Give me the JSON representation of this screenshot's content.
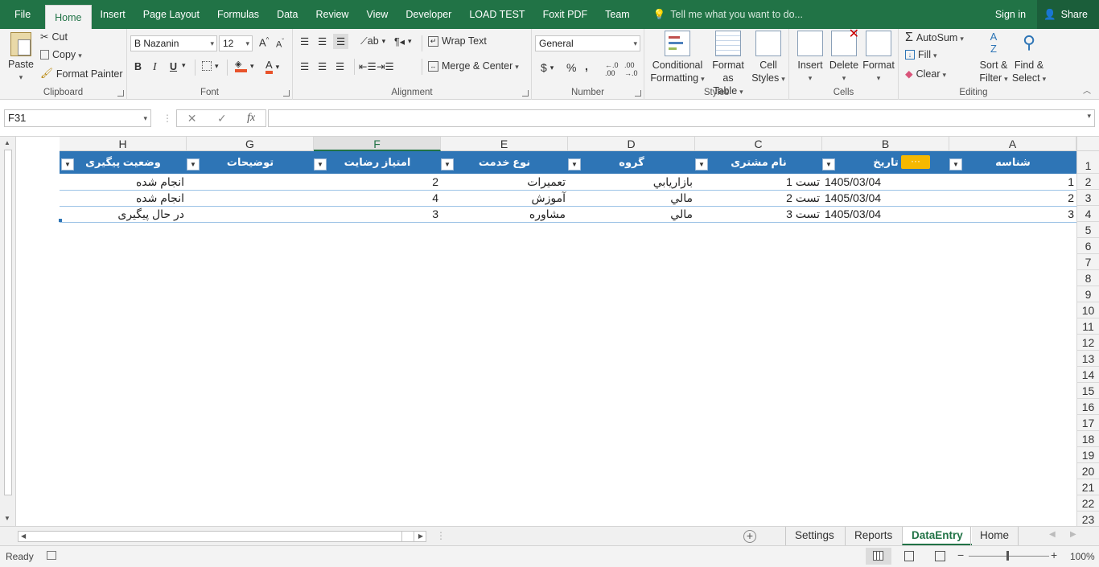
{
  "tabs": [
    "File",
    "Home",
    "Insert",
    "Page Layout",
    "Formulas",
    "Data",
    "Review",
    "View",
    "Developer",
    "LOAD TEST",
    "Foxit PDF",
    "Team"
  ],
  "tell_me": "Tell me what you want to do...",
  "sign_in": "Sign in",
  "share": "Share",
  "clipboard": {
    "label": "Clipboard",
    "paste": "Paste",
    "cut": "Cut",
    "copy": "Copy",
    "format_painter": "Format Painter"
  },
  "font": {
    "label": "Font",
    "name": "B Nazanin",
    "size": "12",
    "bold": "B",
    "italic": "I",
    "underline": "U"
  },
  "alignment": {
    "label": "Alignment",
    "wrap": "Wrap Text",
    "merge": "Merge & Center"
  },
  "number": {
    "label": "Number",
    "format": "General",
    "currency": "$",
    "percent": "%",
    "comma": ","
  },
  "styles": {
    "label": "Styles",
    "conditional": [
      "Conditional",
      "Formatting"
    ],
    "format_table": [
      "Format as",
      "Table"
    ],
    "cell_styles": [
      "Cell",
      "Styles"
    ]
  },
  "cells": {
    "label": "Cells",
    "insert": "Insert",
    "delete": "Delete",
    "format": "Format"
  },
  "editing": {
    "label": "Editing",
    "autosum": "AutoSum",
    "fill": "Fill",
    "clear": "Clear",
    "sort": [
      "Sort &",
      "Filter"
    ],
    "find": [
      "Find &",
      "Select"
    ]
  },
  "name_box": "F31",
  "columns": [
    {
      "letter": "H",
      "header": "وضعیت پیگیری"
    },
    {
      "letter": "G",
      "header": "توضیحات"
    },
    {
      "letter": "F",
      "header": "امتیاز رضایت"
    },
    {
      "letter": "E",
      "header": "نوع خدمت"
    },
    {
      "letter": "D",
      "header": "گروه"
    },
    {
      "letter": "C",
      "header": "نام مشتری"
    },
    {
      "letter": "B",
      "header": "تاریخ"
    },
    {
      "letter": "A",
      "header": "شناسه"
    }
  ],
  "chip": "···",
  "rows": [
    {
      "id": "1",
      "date": "1405/03/04",
      "customer": "تست 1",
      "group": "بازاريابي",
      "service": "تعميرات",
      "score": "2",
      "notes": "",
      "status": "انجام شده"
    },
    {
      "id": "2",
      "date": "1405/03/04",
      "customer": "تست 2",
      "group": "مالي",
      "service": "آموزش",
      "score": "4",
      "notes": "",
      "status": "انجام شده"
    },
    {
      "id": "3",
      "date": "1405/03/04",
      "customer": "تست 3",
      "group": "مالي",
      "service": "مشاوره",
      "score": "3",
      "notes": "",
      "status": "در حال پیگیری"
    }
  ],
  "row_numbers": [
    "1",
    "2",
    "3",
    "4",
    "5",
    "6",
    "7",
    "8",
    "9",
    "10",
    "11",
    "12",
    "13",
    "14",
    "15",
    "16",
    "17",
    "18",
    "19",
    "20",
    "21",
    "22",
    "23"
  ],
  "sheets": [
    "Settings",
    "Reports",
    "DataEntry",
    "Home"
  ],
  "active_sheet": "DataEntry",
  "status": "Ready",
  "zoom": "100%",
  "colors": {
    "brand": "#217346",
    "table_header": "#2e75b6",
    "chip": "#f6b800"
  }
}
